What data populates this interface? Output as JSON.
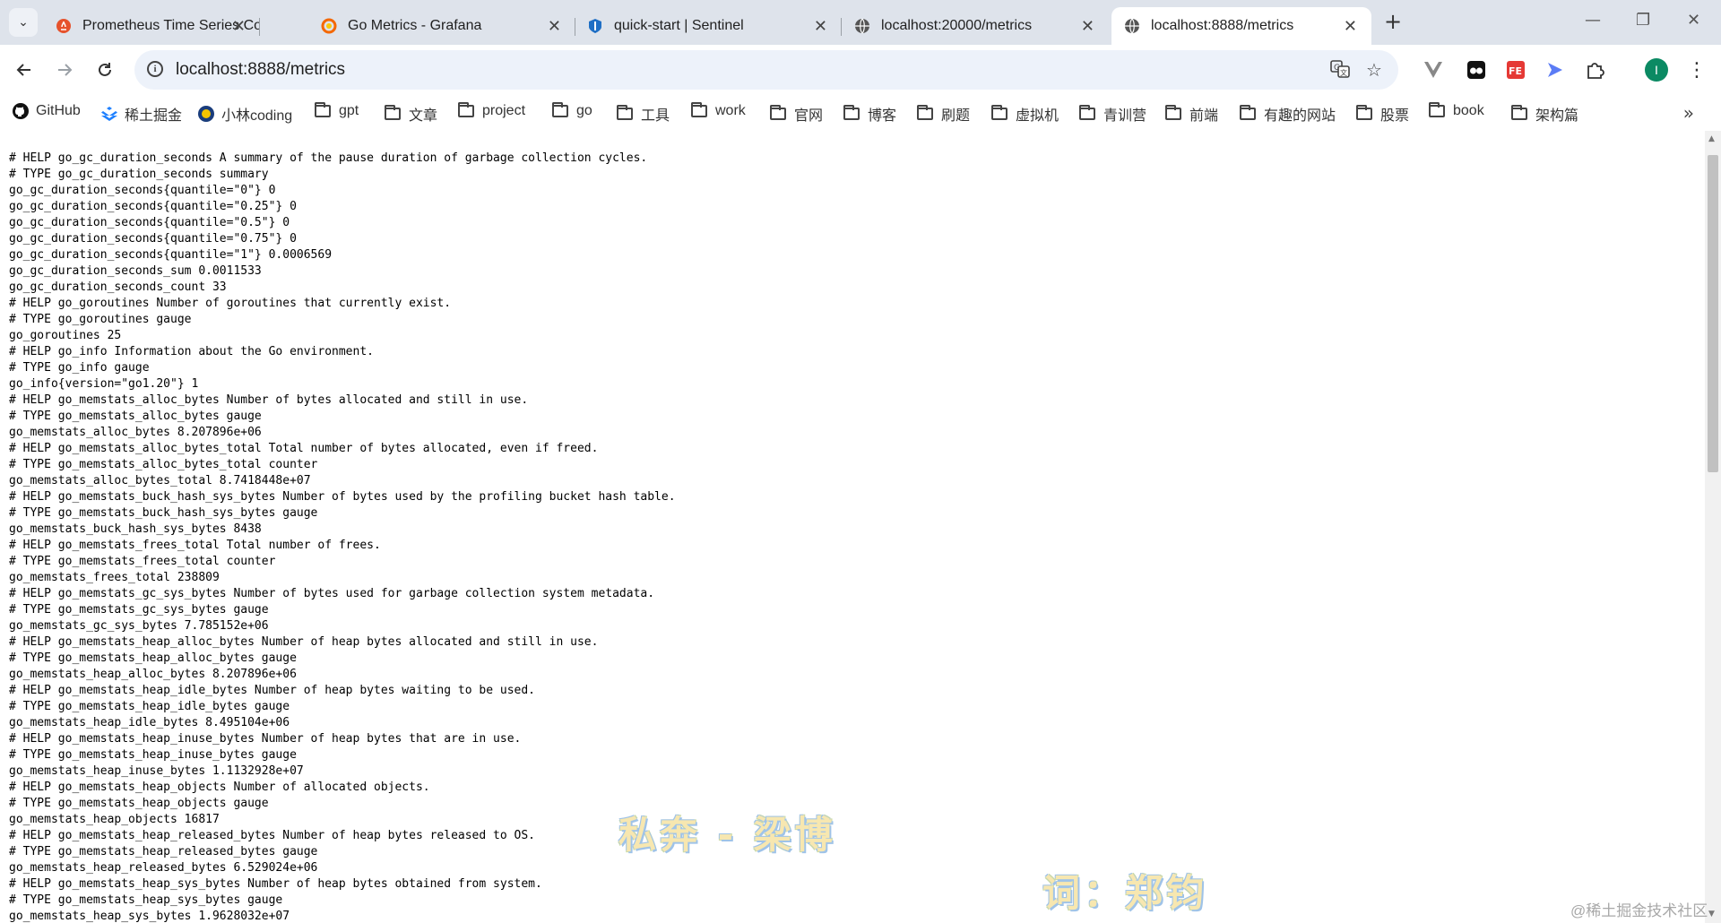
{
  "browser": {
    "tabs": [
      {
        "title": "Prometheus Time Series Colle",
        "icon": "prometheus-icon",
        "active": false
      },
      {
        "title": "Go Metrics - Grafana",
        "icon": "grafana-icon",
        "active": false
      },
      {
        "title": "quick-start | Sentinel",
        "icon": "sentinel-icon",
        "active": false
      },
      {
        "title": "localhost:20000/metrics",
        "icon": "globe-icon",
        "active": false
      },
      {
        "title": "localhost:8888/metrics",
        "icon": "globe-icon",
        "active": true
      }
    ],
    "address": "localhost:8888/metrics",
    "profile_initial": "I",
    "bookmarks": [
      {
        "label": "GitHub",
        "icon": "github-icon"
      },
      {
        "label": "稀土掘金",
        "icon": "juejin-icon"
      },
      {
        "label": "小林coding",
        "icon": "xiaolin-icon"
      },
      {
        "label": "gpt",
        "icon": "folder-icon"
      },
      {
        "label": "文章",
        "icon": "folder-icon"
      },
      {
        "label": "project",
        "icon": "folder-icon"
      },
      {
        "label": "go",
        "icon": "folder-icon"
      },
      {
        "label": "工具",
        "icon": "folder-icon"
      },
      {
        "label": "work",
        "icon": "folder-icon"
      },
      {
        "label": "官网",
        "icon": "folder-icon"
      },
      {
        "label": "博客",
        "icon": "folder-icon"
      },
      {
        "label": "刷题",
        "icon": "folder-icon"
      },
      {
        "label": "虚拟机",
        "icon": "folder-icon"
      },
      {
        "label": "青训营",
        "icon": "folder-icon"
      },
      {
        "label": "前端",
        "icon": "folder-icon"
      },
      {
        "label": "有趣的网站",
        "icon": "folder-icon"
      },
      {
        "label": "股票",
        "icon": "folder-icon"
      },
      {
        "label": "book",
        "icon": "folder-icon"
      },
      {
        "label": "架构篇",
        "icon": "folder-icon"
      }
    ]
  },
  "metrics_lines": [
    "# HELP go_gc_duration_seconds A summary of the pause duration of garbage collection cycles.",
    "# TYPE go_gc_duration_seconds summary",
    "go_gc_duration_seconds{quantile=\"0\"} 0",
    "go_gc_duration_seconds{quantile=\"0.25\"} 0",
    "go_gc_duration_seconds{quantile=\"0.5\"} 0",
    "go_gc_duration_seconds{quantile=\"0.75\"} 0",
    "go_gc_duration_seconds{quantile=\"1\"} 0.0006569",
    "go_gc_duration_seconds_sum 0.0011533",
    "go_gc_duration_seconds_count 33",
    "# HELP go_goroutines Number of goroutines that currently exist.",
    "# TYPE go_goroutines gauge",
    "go_goroutines 25",
    "# HELP go_info Information about the Go environment.",
    "# TYPE go_info gauge",
    "go_info{version=\"go1.20\"} 1",
    "# HELP go_memstats_alloc_bytes Number of bytes allocated and still in use.",
    "# TYPE go_memstats_alloc_bytes gauge",
    "go_memstats_alloc_bytes 8.207896e+06",
    "# HELP go_memstats_alloc_bytes_total Total number of bytes allocated, even if freed.",
    "# TYPE go_memstats_alloc_bytes_total counter",
    "go_memstats_alloc_bytes_total 8.7418448e+07",
    "# HELP go_memstats_buck_hash_sys_bytes Number of bytes used by the profiling bucket hash table.",
    "# TYPE go_memstats_buck_hash_sys_bytes gauge",
    "go_memstats_buck_hash_sys_bytes 8438",
    "# HELP go_memstats_frees_total Total number of frees.",
    "# TYPE go_memstats_frees_total counter",
    "go_memstats_frees_total 238809",
    "# HELP go_memstats_gc_sys_bytes Number of bytes used for garbage collection system metadata.",
    "# TYPE go_memstats_gc_sys_bytes gauge",
    "go_memstats_gc_sys_bytes 7.785152e+06",
    "# HELP go_memstats_heap_alloc_bytes Number of heap bytes allocated and still in use.",
    "# TYPE go_memstats_heap_alloc_bytes gauge",
    "go_memstats_heap_alloc_bytes 8.207896e+06",
    "# HELP go_memstats_heap_idle_bytes Number of heap bytes waiting to be used.",
    "# TYPE go_memstats_heap_idle_bytes gauge",
    "go_memstats_heap_idle_bytes 8.495104e+06",
    "# HELP go_memstats_heap_inuse_bytes Number of heap bytes that are in use.",
    "# TYPE go_memstats_heap_inuse_bytes gauge",
    "go_memstats_heap_inuse_bytes 1.1132928e+07",
    "# HELP go_memstats_heap_objects Number of allocated objects.",
    "# TYPE go_memstats_heap_objects gauge",
    "go_memstats_heap_objects 16817",
    "# HELP go_memstats_heap_released_bytes Number of heap bytes released to OS.",
    "# TYPE go_memstats_heap_released_bytes gauge",
    "go_memstats_heap_released_bytes 6.529024e+06",
    "# HELP go_memstats_heap_sys_bytes Number of heap bytes obtained from system.",
    "# TYPE go_memstats_heap_sys_bytes gauge",
    "go_memstats_heap_sys_bytes 1.9628032e+07"
  ],
  "overlays": {
    "lyric_line": "私奔 - 梁博",
    "lyric_credit": "词：郑钧",
    "watermark": "@稀土掘金技术社区"
  }
}
